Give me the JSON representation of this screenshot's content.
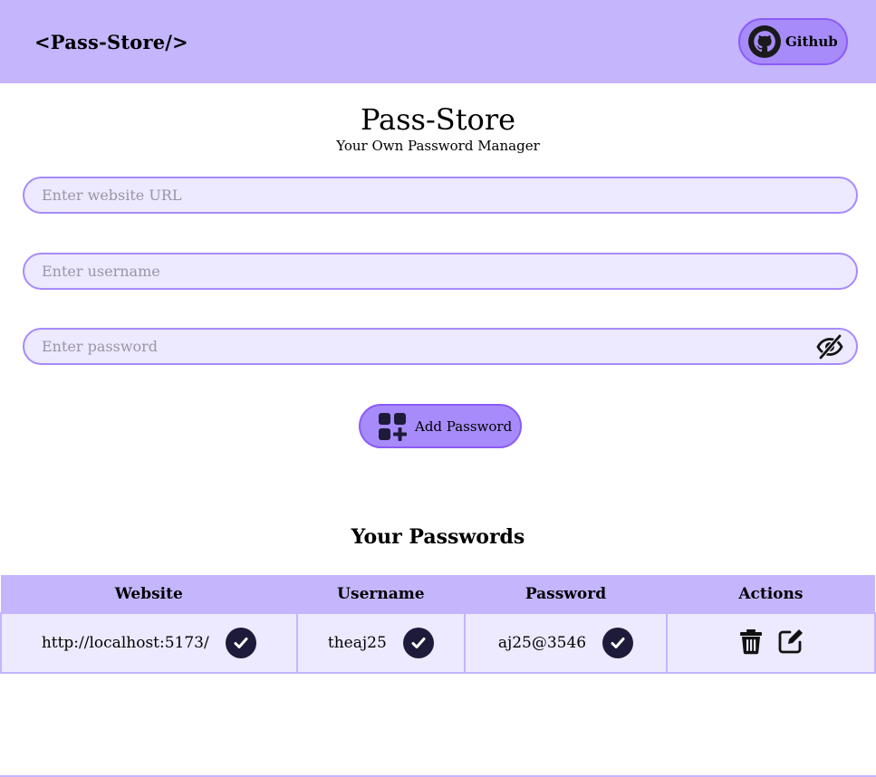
{
  "navbar": {
    "logo": "<Pass-Store/>",
    "github_label": "Github"
  },
  "hero": {
    "title": "Pass-Store",
    "subtitle": "Your Own Password Manager"
  },
  "form": {
    "url_placeholder": "Enter website URL",
    "username_placeholder": "Enter username",
    "password_placeholder": "Enter password",
    "add_button_label": "Add Password"
  },
  "passwords": {
    "title": "Your Passwords",
    "headers": [
      "Website",
      "Username",
      "Password",
      "Actions"
    ],
    "rows": [
      {
        "website": "http://localhost:5173/",
        "username": "theaj25",
        "password": "aj25@3546"
      }
    ]
  },
  "icons": {
    "github": "github-icon",
    "eye": "eye-slash-icon",
    "add": "add-squares-icon",
    "copy": "check-circle-icon",
    "delete": "trash-icon",
    "edit": "edit-icon"
  },
  "colors": {
    "accent": "#c4b5fd",
    "button": "#a78bfa",
    "field_bg": "#ede9fe",
    "dark": "#1e1b3a"
  }
}
